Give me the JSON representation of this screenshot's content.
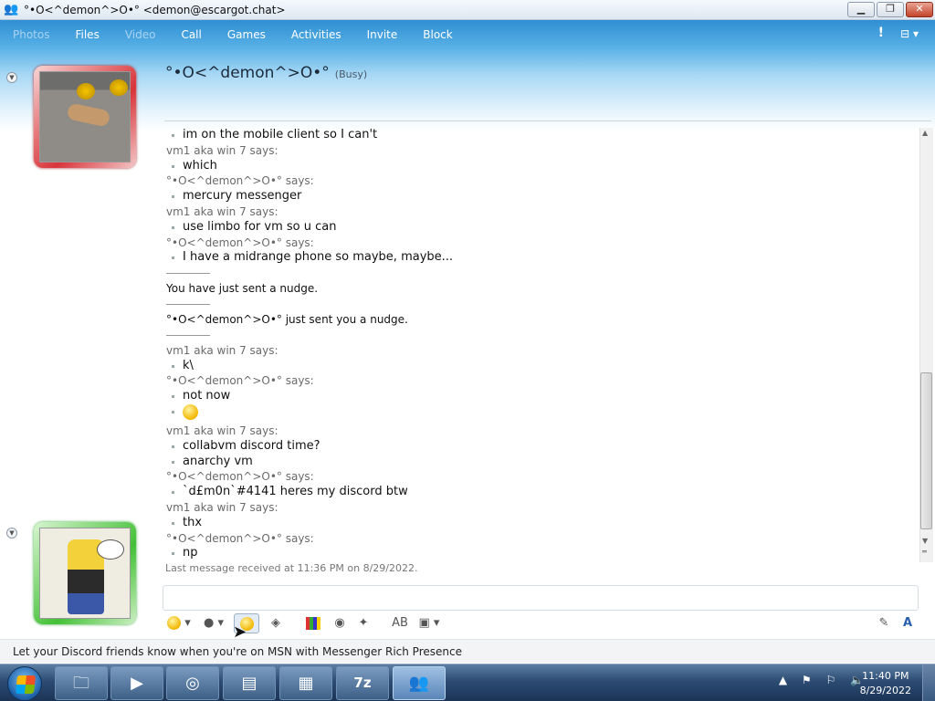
{
  "window": {
    "title": "°•O<^demon^>O•° <demon@escargot.chat>",
    "controls": {
      "minimize": "▁",
      "restore": "❐",
      "close": "✕"
    }
  },
  "menubar": {
    "items": [
      {
        "label": "Photos",
        "enabled": false
      },
      {
        "label": "Files",
        "enabled": true
      },
      {
        "label": "Video",
        "enabled": false
      },
      {
        "label": "Call",
        "enabled": true
      },
      {
        "label": "Games",
        "enabled": true
      },
      {
        "label": "Activities",
        "enabled": true
      },
      {
        "label": "Invite",
        "enabled": true
      },
      {
        "label": "Block",
        "enabled": true
      }
    ],
    "alert_glyph": "!",
    "options_glyph": "⊟ ▾"
  },
  "contact": {
    "name": "°•O<^demon^>O•°",
    "status": "(Busy)"
  },
  "conversation": [
    {
      "kind": "msg",
      "text": "im on the mobile client so I can't"
    },
    {
      "kind": "sender",
      "text": "vm1 aka win 7 says:"
    },
    {
      "kind": "msg",
      "text": "which"
    },
    {
      "kind": "sender",
      "text": "°•O<^demon^>O•° says:"
    },
    {
      "kind": "msg",
      "text": "mercury messenger"
    },
    {
      "kind": "sender",
      "text": "vm1 aka win 7 says:"
    },
    {
      "kind": "msg",
      "text": "use limbo for vm so u can"
    },
    {
      "kind": "sender",
      "text": "°•O<^demon^>O•° says:"
    },
    {
      "kind": "msg",
      "text": "I have a midrange phone so maybe, maybe..."
    },
    {
      "kind": "sep",
      "text": ""
    },
    {
      "kind": "system",
      "text": "You have just sent a nudge."
    },
    {
      "kind": "sep",
      "text": ""
    },
    {
      "kind": "system",
      "text": "°•O<^demon^>O•° just sent you a nudge."
    },
    {
      "kind": "sep",
      "text": ""
    },
    {
      "kind": "sender",
      "text": "vm1 aka win 7 says:"
    },
    {
      "kind": "msg",
      "text": "k\\"
    },
    {
      "kind": "sender",
      "text": "°•O<^demon^>O•° says:"
    },
    {
      "kind": "msg",
      "text": "not now"
    },
    {
      "kind": "emoticon",
      "text": ""
    },
    {
      "kind": "sender",
      "text": "vm1 aka win 7 says:"
    },
    {
      "kind": "msg",
      "text": "collabvm discord time?"
    },
    {
      "kind": "msg",
      "text": "anarchy vm"
    },
    {
      "kind": "sender",
      "text": "°•O<^demon^>O•° says:"
    },
    {
      "kind": "msg",
      "text": "`d£m0n`#4141 heres my discord btw"
    },
    {
      "kind": "sender",
      "text": "vm1 aka win 7 says:"
    },
    {
      "kind": "msg",
      "text": "thx"
    },
    {
      "kind": "sender",
      "text": "°•O<^demon^>O•° says:"
    },
    {
      "kind": "msg",
      "text": "np"
    }
  ],
  "last_received": "Last message received at 11:36 PM on 8/29/2022.",
  "ad": "Let your Discord friends know when you're on MSN with Messenger Rich Presence",
  "taskbar": {
    "tasks": [
      "explorer-icon",
      "media-player-icon",
      "chrome-icon",
      "notepad-icon",
      "remote-icon",
      "7zip-icon",
      "messenger-icon"
    ],
    "sevenzip_label": "7z",
    "tray": "▲ ⚑ ⚐ 🔈",
    "time": "11:40 PM",
    "date": "8/29/2022"
  },
  "colors": {
    "busy_frame": "#d8343a",
    "online_frame": "#43c036",
    "accent": "#2f8fd3"
  }
}
